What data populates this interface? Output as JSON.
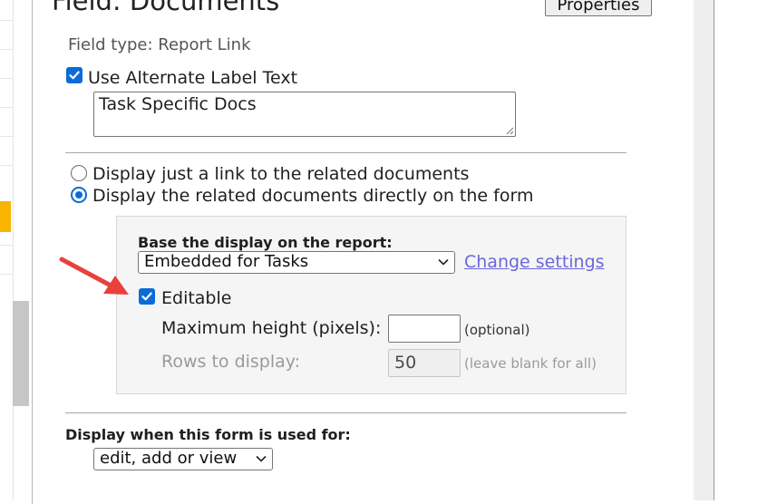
{
  "dialog": {
    "title": "Field: Documents",
    "properties_button": "Properties",
    "field_type": "Field type: Report Link"
  },
  "alternate_label": {
    "checkbox_label": "Use Alternate Label Text",
    "checked": true,
    "text_value": "Task Specific Docs"
  },
  "display_mode": {
    "options": [
      {
        "label": "Display just a link to the related documents",
        "selected": false
      },
      {
        "label": "Display the related documents directly on the form",
        "selected": true
      }
    ]
  },
  "report_settings": {
    "base_label": "Base the display on the report:",
    "report_selected": "Embedded for Tasks",
    "change_settings_link": "Change settings",
    "editable_label": "Editable",
    "editable_checked": true,
    "max_height_label": "Maximum height (pixels):",
    "max_height_value": "",
    "max_height_note": "(optional)",
    "rows_label": "Rows to display:",
    "rows_value": "50",
    "rows_note": "(leave blank for all)"
  },
  "usage": {
    "label": "Display when this form is used for:",
    "selected": "edit, add or view"
  },
  "colors": {
    "accent": "#0a6cd6",
    "link": "#6b67d9",
    "annotation_arrow": "#e8413c"
  }
}
